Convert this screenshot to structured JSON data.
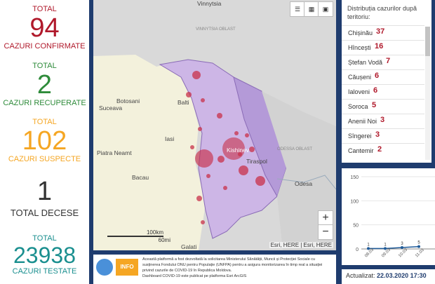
{
  "stats": {
    "confirmed": {
      "label": "TOTAL",
      "value": "94",
      "caption": "CAZURI CONFIRMATE"
    },
    "recovered": {
      "label": "TOTAL",
      "value": "2",
      "caption": "CAZURI RECUPERATE"
    },
    "suspected": {
      "label": "TOTAL",
      "value": "102",
      "caption": "CAZURI SUSPECTE"
    },
    "deaths": {
      "value": "1",
      "caption": "TOTAL DECESE"
    },
    "tested": {
      "label": "TOTAL",
      "value": "23938",
      "caption": "CAZURI TESTATE"
    }
  },
  "map": {
    "places": [
      "Vinnytsia",
      "VINNYTSIA OBLAST",
      "Botosani",
      "Suceava",
      "Balti",
      "Iasi",
      "Piatra Neamt",
      "Kishinev",
      "Tiraspol",
      "ODESSA OBLAST",
      "Bacau",
      "Odesa",
      "Galati"
    ],
    "scale_km": "100km",
    "scale_mi": "60mi",
    "attribution": "Esri, HERE | Esri, HERE",
    "zoom_in": "+",
    "zoom_out": "−"
  },
  "distribution": {
    "title": "Distribuția cazurilor după teritoriu:",
    "items": [
      {
        "name": "Chișinău",
        "value": "37"
      },
      {
        "name": "Hîncești",
        "value": "16"
      },
      {
        "name": "Ștefan Vodă",
        "value": "7"
      },
      {
        "name": "Căușeni",
        "value": "6"
      },
      {
        "name": "Ialoveni",
        "value": "6"
      },
      {
        "name": "Soroca",
        "value": "5"
      },
      {
        "name": "Anenii Noi",
        "value": "3"
      },
      {
        "name": "Sîngerei",
        "value": "3"
      },
      {
        "name": "Cantemir",
        "value": "2"
      }
    ]
  },
  "chart_data": {
    "type": "line",
    "categories": [
      "08.03",
      "09.03",
      "10.03",
      "11.03"
    ],
    "values": [
      1,
      1,
      3,
      5
    ],
    "point_labels": [
      "1",
      "1",
      "3",
      "5"
    ],
    "yticks": [
      "150",
      "100",
      "50",
      "0"
    ],
    "ylim": [
      0,
      150
    ]
  },
  "info": {
    "text": "Această platformă a fost dezvoltată la solicitarea Ministerului Sănătății, Muncii și Protecției Sociale cu susținerea Fondului ONU pentru Populație (UNFPA) pentru a asigura monitorizarea în timp real a situației privind cazurile de COVID-19 în Republica Moldova.",
    "text2": "Dashboard COVID-19 este publicat pe platforma Esri ArcGIS",
    "logo_text": "INFO"
  },
  "updated": {
    "label": "Actualizat:",
    "value": "22.03.2020 17:30"
  }
}
